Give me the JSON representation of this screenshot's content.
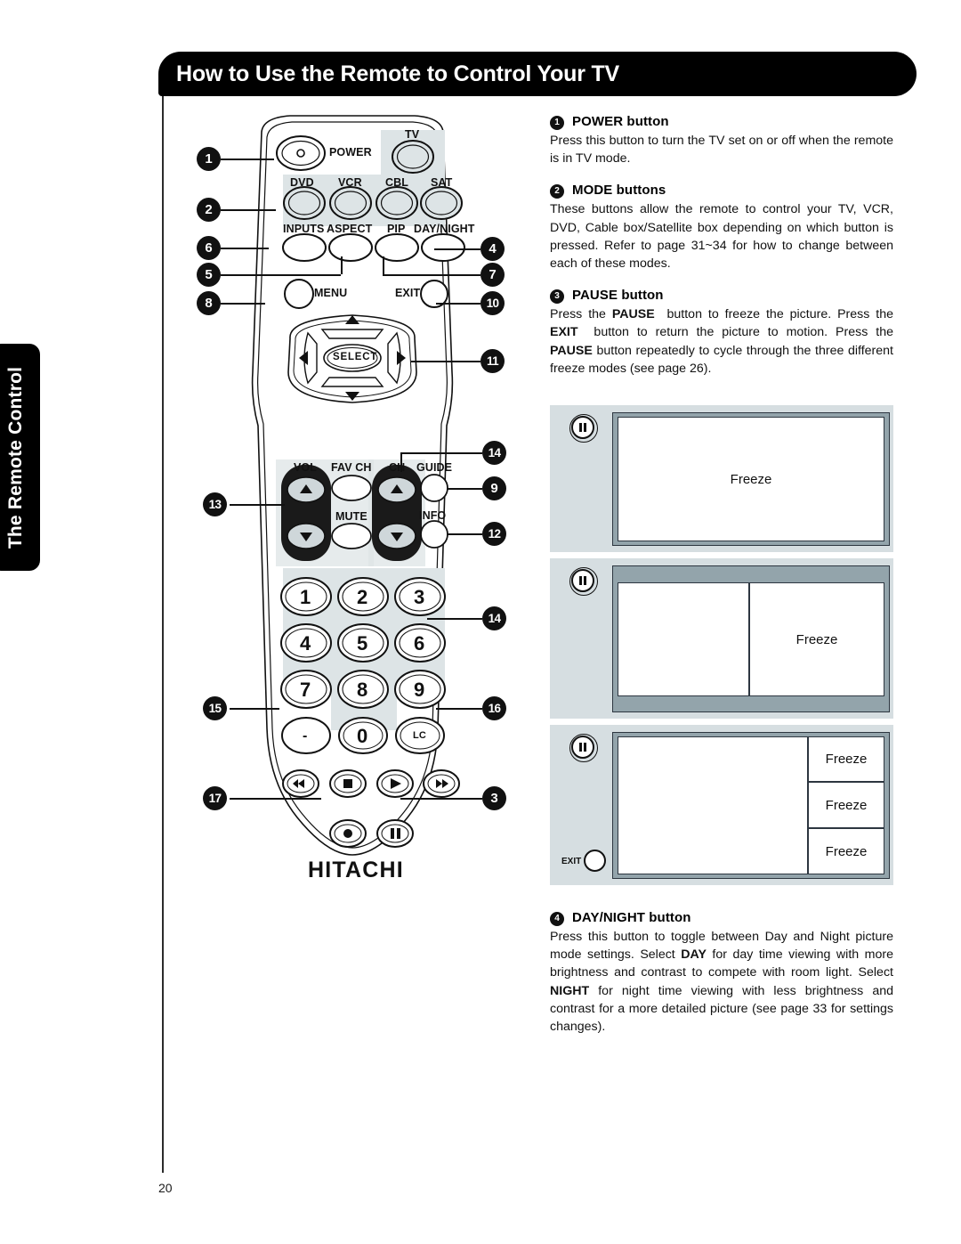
{
  "header": {
    "title": "How to Use the Remote to Control Your TV"
  },
  "side_tab": {
    "label": "The Remote Control"
  },
  "page_number": "20",
  "remote": {
    "brand": "HITACHI",
    "labels": {
      "power": "POWER",
      "tv": "TV",
      "dvd": "DVD",
      "vcr": "VCR",
      "cbl": "CBL",
      "sat": "SAT",
      "inputs": "INPUTS",
      "aspect": "ASPECT",
      "pip": "PIP",
      "daynight": "DAY/NIGHT",
      "menu": "MENU",
      "exit": "EXIT",
      "select": "SELECT",
      "vol": "VOL",
      "fav_ch": "FAV CH",
      "ch": "CH",
      "guide": "GUIDE",
      "mute": "MUTE",
      "info": "INFO",
      "lc": "LC",
      "dash": "-"
    },
    "keypad": [
      "1",
      "2",
      "3",
      "4",
      "5",
      "6",
      "7",
      "8",
      "9",
      "0"
    ],
    "callouts": {
      "c1": "1",
      "c2": "2",
      "c3": "3",
      "c4": "4",
      "c5": "5",
      "c6": "6",
      "c7": "7",
      "c8": "8",
      "c9": "9",
      "c10": "10",
      "c11": "11",
      "c12": "12",
      "c13": "13",
      "c14a": "14",
      "c14b": "14",
      "c15": "15",
      "c16": "16",
      "c17": "17"
    }
  },
  "text_items": [
    {
      "num": "1",
      "title": "POWER button",
      "body_html": "Press this button to turn the TV set on or off when the remote is in TV mode."
    },
    {
      "num": "2",
      "title": "MODE buttons",
      "body_html": "These buttons allow the remote to control your TV, VCR, DVD, Cable box/Satellite box depending on which button is pressed.  Refer to page 31~34 for how to change between each of these modes."
    },
    {
      "num": "3",
      "title": "PAUSE button",
      "body_html": "Press the <b>PAUSE</b>&nbsp; button to freeze the picture. Press the <b>EXIT</b>&nbsp; button to return the picture to motion. Press the <b>PAUSE</b> button repeatedly to cycle through the three different freeze modes (see page 26)."
    }
  ],
  "daynight_item": {
    "num": "4",
    "title": "DAY/NIGHT button",
    "body_html": "Press this button to toggle between Day and Night picture mode settings. Select <b>DAY</b> for day time viewing with more brightness and contrast to compete with room light. Select <b>NIGHT</b> for night time viewing with less brightness and contrast for a more detailed picture (see page 33 for settings changes)."
  },
  "freeze_diagrams": {
    "label_freeze": "Freeze",
    "exit_label": "EXIT",
    "panel1": {
      "freeze_count": 1
    },
    "panel2": {
      "freeze_count": 1
    },
    "panel3": {
      "freeze_count": 3
    }
  },
  "colors": {
    "panel_bg": "#d6dee1",
    "tv_frame": "#93a4ab",
    "screen": "#ffffff",
    "ink": "#111111",
    "keypad_shade": "#dde4e6",
    "rocker_dark": "#1a1a1a"
  }
}
